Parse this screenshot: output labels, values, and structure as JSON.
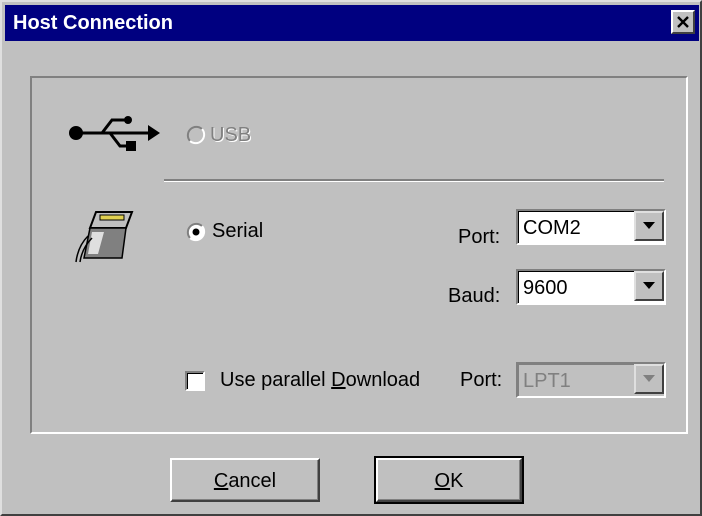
{
  "window": {
    "title": "Host Connection",
    "close_icon": "close-icon"
  },
  "usb": {
    "label": "USB",
    "selected": false,
    "enabled": false,
    "icon": "usb-icon"
  },
  "serial": {
    "label": "Serial",
    "selected": true,
    "enabled": true,
    "icon": "serial-cable-icon",
    "port_label": "Port:",
    "port_value": "COM2",
    "baud_label": "Baud:",
    "baud_value": "9600"
  },
  "parallel": {
    "checkbox_label_pre": "Use parallel ",
    "checkbox_label_mnemonic": "D",
    "checkbox_label_post": "ownload",
    "checked": false,
    "port_label": "Port:",
    "port_value": "LPT1",
    "port_enabled": false
  },
  "buttons": {
    "cancel_mnemonic": "C",
    "cancel_rest": "ancel",
    "ok_mnemonic": "O",
    "ok_rest": "K"
  }
}
